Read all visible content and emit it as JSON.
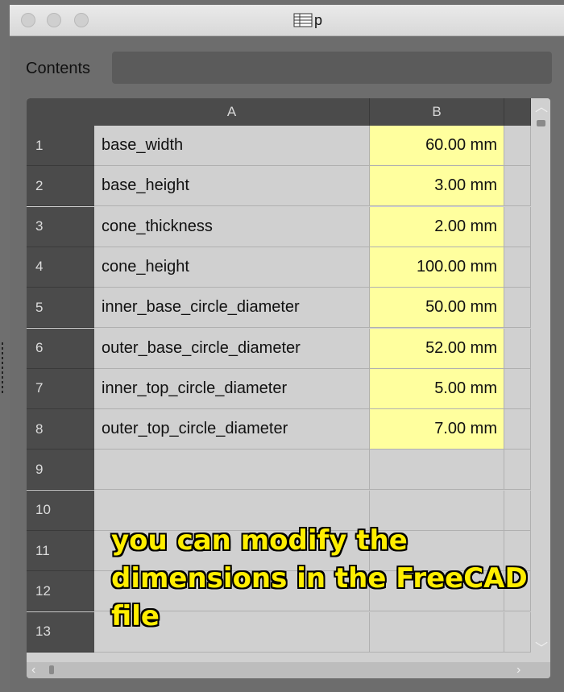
{
  "window": {
    "title": "p"
  },
  "contents": {
    "label": "Contents",
    "value": ""
  },
  "columns": [
    "A",
    "B"
  ],
  "rows": [
    {
      "num": "1",
      "a": "base_width",
      "b": "60.00 mm"
    },
    {
      "num": "2",
      "a": "base_height",
      "b": "3.00 mm"
    },
    {
      "num": "3",
      "a": "cone_thickness",
      "b": "2.00 mm"
    },
    {
      "num": "4",
      "a": "cone_height",
      "b": "100.00 mm"
    },
    {
      "num": "5",
      "a": "inner_base_circle_diameter",
      "b": "50.00 mm"
    },
    {
      "num": "6",
      "a": "outer_base_circle_diameter",
      "b": "52.00 mm"
    },
    {
      "num": "7",
      "a": "inner_top_circle_diameter",
      "b": "5.00 mm"
    },
    {
      "num": "8",
      "a": "outer_top_circle_diameter",
      "b": "7.00 mm"
    },
    {
      "num": "9",
      "a": "",
      "b": ""
    },
    {
      "num": "10",
      "a": "",
      "b": ""
    },
    {
      "num": "11",
      "a": "",
      "b": ""
    },
    {
      "num": "12",
      "a": "",
      "b": ""
    },
    {
      "num": "13",
      "a": "",
      "b": ""
    }
  ],
  "caption": "you can modify the dimensions in the FreeCAD file",
  "colors": {
    "highlight": "#ffff9e",
    "caption": "#ffee00"
  }
}
